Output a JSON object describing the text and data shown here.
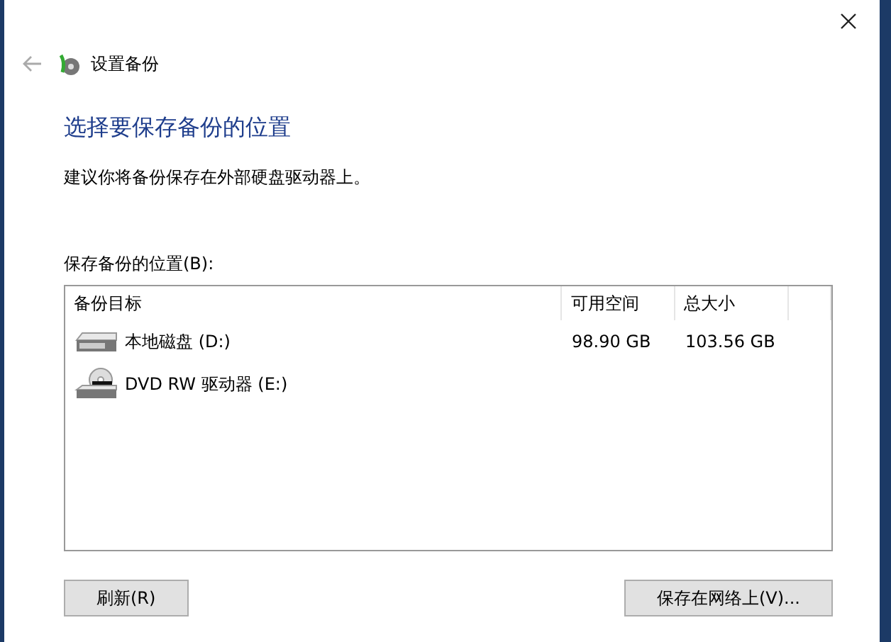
{
  "window": {
    "title": "设置备份"
  },
  "heading": "选择要保存备份的位置",
  "description": "建议你将备份保存在外部硬盘驱动器上。",
  "list_label": "保存备份的位置(B):",
  "table": {
    "columns": [
      "备份目标",
      "可用空间",
      "总大小"
    ],
    "rows": [
      {
        "kind": "disk",
        "name": "本地磁盘 (D:)",
        "free": "98.90 GB",
        "total": "103.56 GB",
        "selected": false
      },
      {
        "kind": "dvd",
        "name": "DVD RW 驱动器 (E:)",
        "selected": false
      }
    ]
  },
  "buttons": {
    "refresh": "刷新(R)",
    "network": "保存在网络上(V)..."
  }
}
